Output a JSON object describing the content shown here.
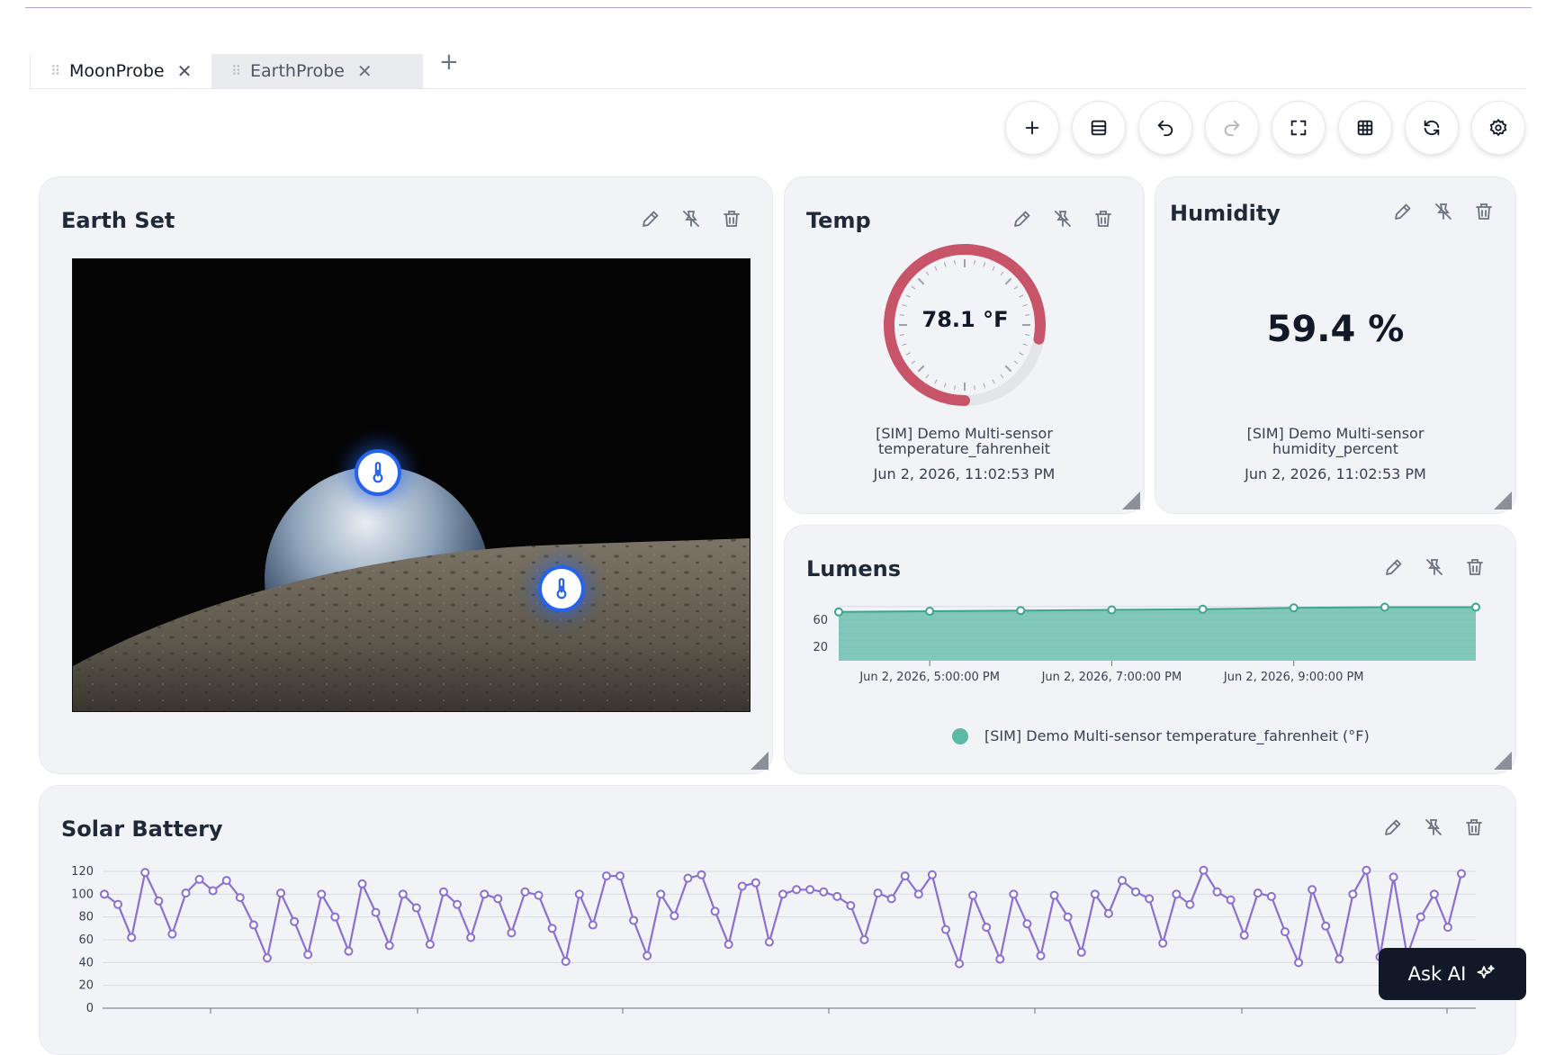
{
  "tabs": [
    {
      "label": "MoonProbe",
      "active": true
    },
    {
      "label": "EarthProbe",
      "active": false
    }
  ],
  "add_tab_label": "+",
  "toolbar": [
    "plus-icon",
    "layout-icon",
    "undo-icon",
    "redo-icon",
    "fullscreen-icon",
    "grid-icon",
    "refresh-icon",
    "settings-icon"
  ],
  "cards": {
    "earth_set": {
      "title": "Earth Set"
    },
    "temp": {
      "title": "Temp",
      "value": "78.1 °F",
      "gauge_fraction": 0.78,
      "sensor": "[SIM] Demo Multi-sensor",
      "field": "temperature_fahrenheit",
      "timestamp": "Jun 2, 2026, 11:02:53 PM"
    },
    "humidity": {
      "title": "Humidity",
      "value": "59.4 %",
      "sensor": "[SIM] Demo Multi-sensor",
      "field": "humidity_percent",
      "timestamp": "Jun 2, 2026, 11:02:53 PM"
    },
    "lumens": {
      "title": "Lumens",
      "legend": "[SIM] Demo Multi-sensor temperature_fahrenheit (°F)"
    },
    "solar_battery": {
      "title": "Solar Battery"
    }
  },
  "ask_ai_label": "Ask AI",
  "colors": {
    "accent_teal": "#5bb9a6",
    "gauge_red": "#c8546a",
    "line_purple": "#8b6fd1",
    "pin_blue": "#2563eb"
  },
  "chart_data": [
    {
      "type": "area",
      "title": "Lumens",
      "x_tick_labels": [
        "Jun 2, 2026, 5:00:00 PM",
        "Jun 2, 2026, 7:00:00 PM",
        "Jun 2, 2026, 9:00:00 PM"
      ],
      "y_tick_labels": [
        "60",
        "20"
      ],
      "series": [
        {
          "name": "[SIM] Demo Multi-sensor temperature_fahrenheit (°F)",
          "values": [
            72,
            73,
            74,
            75,
            76,
            78,
            79,
            79
          ]
        }
      ],
      "ylim": [
        0,
        85
      ],
      "legend": "bottom-center",
      "grid": true
    },
    {
      "type": "line",
      "title": "Solar Battery",
      "y_tick_labels": [
        "120",
        "100",
        "80",
        "60",
        "40",
        "20",
        "0"
      ],
      "ylim": [
        0,
        120
      ],
      "grid": true,
      "series": [
        {
          "values": [
            100,
            91,
            62,
            119,
            94,
            65,
            101,
            113,
            103,
            112,
            97,
            73,
            44,
            101,
            76,
            47,
            100,
            80,
            50,
            109,
            84,
            55,
            100,
            88,
            56,
            102,
            91,
            62,
            100,
            96,
            66,
            102,
            99,
            70,
            41,
            100,
            73,
            116,
            116,
            77,
            46,
            100,
            81,
            114,
            117,
            85,
            56,
            107,
            110,
            58,
            100,
            104,
            104,
            102,
            98,
            90,
            60,
            101,
            96,
            116,
            100,
            117,
            69,
            39,
            99,
            71,
            43,
            100,
            74,
            46,
            99,
            80,
            49,
            100,
            83,
            112,
            102,
            96,
            57,
            100,
            91,
            121,
            102,
            95,
            64,
            101,
            98,
            67,
            40,
            104,
            72,
            43,
            100,
            121,
            45,
            115,
            46,
            80,
            100,
            71,
            118
          ]
        }
      ]
    }
  ]
}
